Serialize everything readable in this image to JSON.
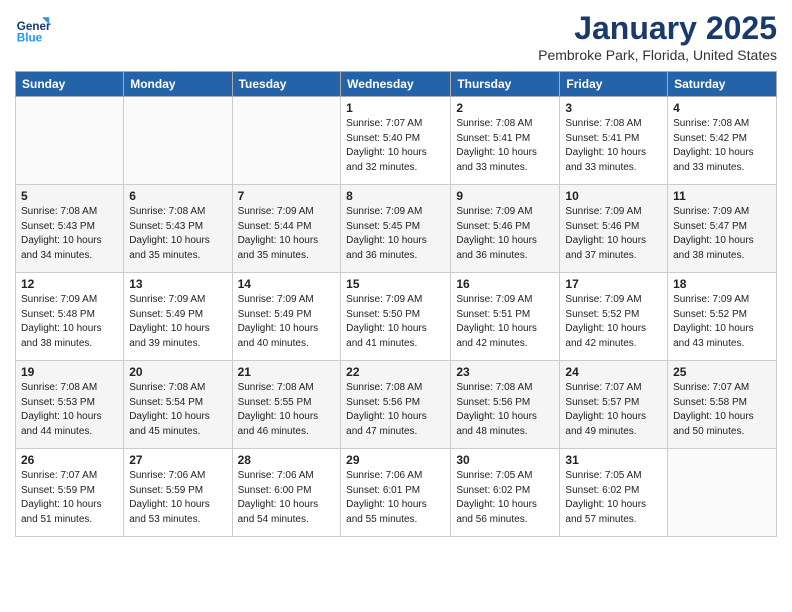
{
  "logo": {
    "line1": "General",
    "line2": "Blue"
  },
  "title": "January 2025",
  "location": "Pembroke Park, Florida, United States",
  "weekdays": [
    "Sunday",
    "Monday",
    "Tuesday",
    "Wednesday",
    "Thursday",
    "Friday",
    "Saturday"
  ],
  "weeks": [
    [
      {
        "day": "",
        "info": ""
      },
      {
        "day": "",
        "info": ""
      },
      {
        "day": "",
        "info": ""
      },
      {
        "day": "1",
        "info": "Sunrise: 7:07 AM\nSunset: 5:40 PM\nDaylight: 10 hours\nand 32 minutes."
      },
      {
        "day": "2",
        "info": "Sunrise: 7:08 AM\nSunset: 5:41 PM\nDaylight: 10 hours\nand 33 minutes."
      },
      {
        "day": "3",
        "info": "Sunrise: 7:08 AM\nSunset: 5:41 PM\nDaylight: 10 hours\nand 33 minutes."
      },
      {
        "day": "4",
        "info": "Sunrise: 7:08 AM\nSunset: 5:42 PM\nDaylight: 10 hours\nand 33 minutes."
      }
    ],
    [
      {
        "day": "5",
        "info": "Sunrise: 7:08 AM\nSunset: 5:43 PM\nDaylight: 10 hours\nand 34 minutes."
      },
      {
        "day": "6",
        "info": "Sunrise: 7:08 AM\nSunset: 5:43 PM\nDaylight: 10 hours\nand 35 minutes."
      },
      {
        "day": "7",
        "info": "Sunrise: 7:09 AM\nSunset: 5:44 PM\nDaylight: 10 hours\nand 35 minutes."
      },
      {
        "day": "8",
        "info": "Sunrise: 7:09 AM\nSunset: 5:45 PM\nDaylight: 10 hours\nand 36 minutes."
      },
      {
        "day": "9",
        "info": "Sunrise: 7:09 AM\nSunset: 5:46 PM\nDaylight: 10 hours\nand 36 minutes."
      },
      {
        "day": "10",
        "info": "Sunrise: 7:09 AM\nSunset: 5:46 PM\nDaylight: 10 hours\nand 37 minutes."
      },
      {
        "day": "11",
        "info": "Sunrise: 7:09 AM\nSunset: 5:47 PM\nDaylight: 10 hours\nand 38 minutes."
      }
    ],
    [
      {
        "day": "12",
        "info": "Sunrise: 7:09 AM\nSunset: 5:48 PM\nDaylight: 10 hours\nand 38 minutes."
      },
      {
        "day": "13",
        "info": "Sunrise: 7:09 AM\nSunset: 5:49 PM\nDaylight: 10 hours\nand 39 minutes."
      },
      {
        "day": "14",
        "info": "Sunrise: 7:09 AM\nSunset: 5:49 PM\nDaylight: 10 hours\nand 40 minutes."
      },
      {
        "day": "15",
        "info": "Sunrise: 7:09 AM\nSunset: 5:50 PM\nDaylight: 10 hours\nand 41 minutes."
      },
      {
        "day": "16",
        "info": "Sunrise: 7:09 AM\nSunset: 5:51 PM\nDaylight: 10 hours\nand 42 minutes."
      },
      {
        "day": "17",
        "info": "Sunrise: 7:09 AM\nSunset: 5:52 PM\nDaylight: 10 hours\nand 42 minutes."
      },
      {
        "day": "18",
        "info": "Sunrise: 7:09 AM\nSunset: 5:52 PM\nDaylight: 10 hours\nand 43 minutes."
      }
    ],
    [
      {
        "day": "19",
        "info": "Sunrise: 7:08 AM\nSunset: 5:53 PM\nDaylight: 10 hours\nand 44 minutes."
      },
      {
        "day": "20",
        "info": "Sunrise: 7:08 AM\nSunset: 5:54 PM\nDaylight: 10 hours\nand 45 minutes."
      },
      {
        "day": "21",
        "info": "Sunrise: 7:08 AM\nSunset: 5:55 PM\nDaylight: 10 hours\nand 46 minutes."
      },
      {
        "day": "22",
        "info": "Sunrise: 7:08 AM\nSunset: 5:56 PM\nDaylight: 10 hours\nand 47 minutes."
      },
      {
        "day": "23",
        "info": "Sunrise: 7:08 AM\nSunset: 5:56 PM\nDaylight: 10 hours\nand 48 minutes."
      },
      {
        "day": "24",
        "info": "Sunrise: 7:07 AM\nSunset: 5:57 PM\nDaylight: 10 hours\nand 49 minutes."
      },
      {
        "day": "25",
        "info": "Sunrise: 7:07 AM\nSunset: 5:58 PM\nDaylight: 10 hours\nand 50 minutes."
      }
    ],
    [
      {
        "day": "26",
        "info": "Sunrise: 7:07 AM\nSunset: 5:59 PM\nDaylight: 10 hours\nand 51 minutes."
      },
      {
        "day": "27",
        "info": "Sunrise: 7:06 AM\nSunset: 5:59 PM\nDaylight: 10 hours\nand 53 minutes."
      },
      {
        "day": "28",
        "info": "Sunrise: 7:06 AM\nSunset: 6:00 PM\nDaylight: 10 hours\nand 54 minutes."
      },
      {
        "day": "29",
        "info": "Sunrise: 7:06 AM\nSunset: 6:01 PM\nDaylight: 10 hours\nand 55 minutes."
      },
      {
        "day": "30",
        "info": "Sunrise: 7:05 AM\nSunset: 6:02 PM\nDaylight: 10 hours\nand 56 minutes."
      },
      {
        "day": "31",
        "info": "Sunrise: 7:05 AM\nSunset: 6:02 PM\nDaylight: 10 hours\nand 57 minutes."
      },
      {
        "day": "",
        "info": ""
      }
    ]
  ]
}
